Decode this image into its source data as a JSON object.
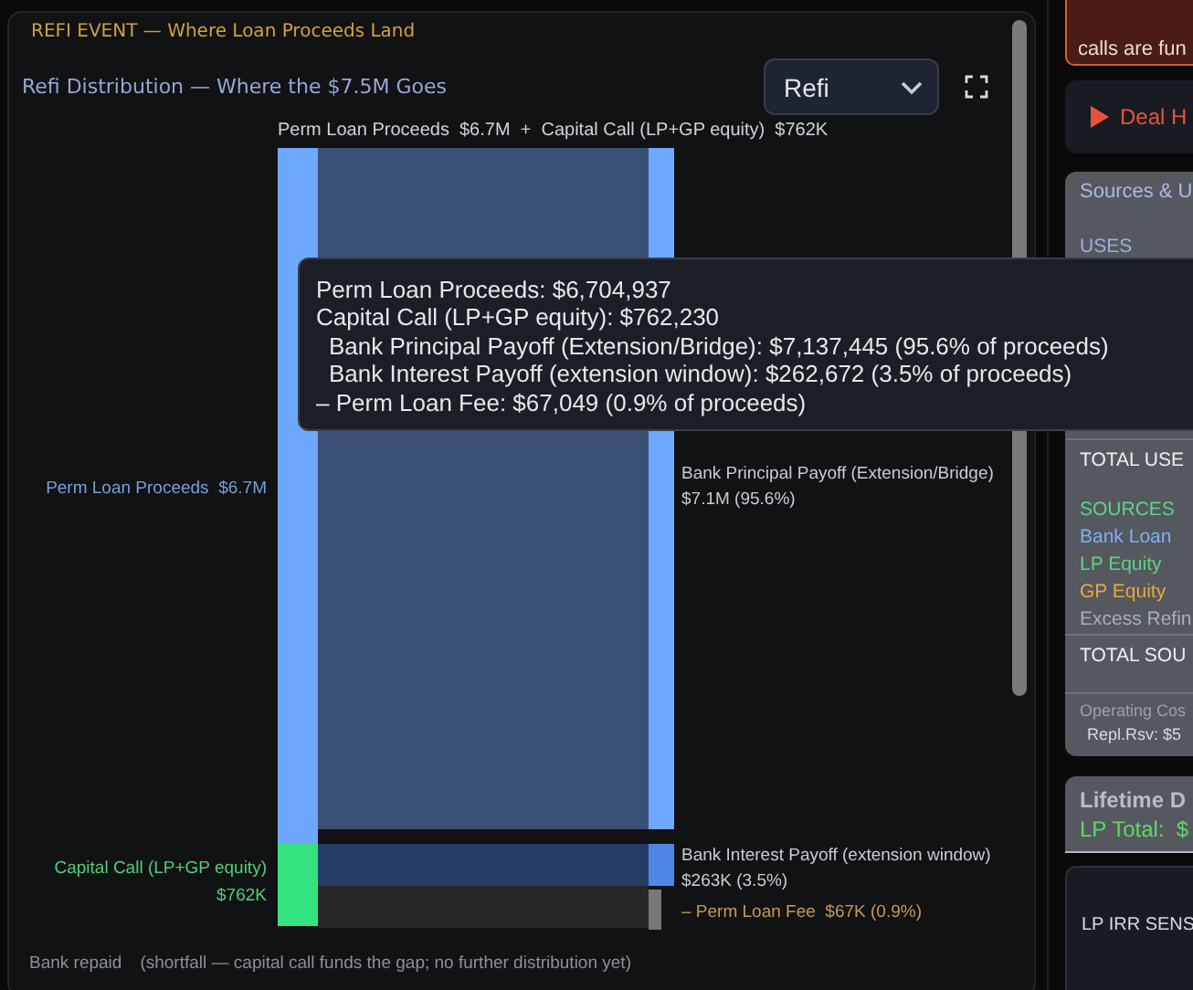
{
  "panel": {
    "caption": "REFI EVENT — Where Loan Proceeds Land",
    "title": "Refi Distribution — Where the $7.5M Goes",
    "view_select": {
      "value": "Refi"
    },
    "flow": {
      "header": "Perm Loan Proceeds  $6.7M  +  Capital Call (LP+GP equity)  $762K",
      "sources": [
        {
          "lines": [
            "Perm Loan Proceeds  $6.7M"
          ],
          "color": "#6ea8fe"
        },
        {
          "lines": [
            "Capital Call (LP+GP equity)",
            "$762K"
          ],
          "color": "#34e37f"
        }
      ],
      "uses": [
        {
          "lines": [
            "Bank Principal Payoff (Extension/Bridge)",
            "$7.1M (95.6%)"
          ],
          "color": "#6ea8fe"
        },
        {
          "lines": [
            "Bank Interest Payoff (extension window)",
            "$263K (3.5%)"
          ],
          "color": "#4f85e6"
        },
        {
          "lines": [
            "– Perm Loan Fee  $67K (0.9%)"
          ],
          "color": "#777777"
        }
      ]
    },
    "footer": {
      "status": "Bank repaid",
      "note": "(shortfall — capital call funds the gap; no further distribution yet)"
    },
    "tooltip": {
      "lines": [
        {
          "text": "Perm Loan Proceeds: $6,704,937",
          "indent": false
        },
        {
          "text": "Capital Call (LP+GP equity): $762,230",
          "indent": false
        },
        {
          "text": "Bank Principal Payoff (Extension/Bridge): $7,137,445 (95.6% of proceeds)",
          "indent": true
        },
        {
          "text": "Bank Interest Payoff (extension window): $262,672 (3.5% of proceeds)",
          "indent": true
        },
        {
          "text": "– Perm Loan Fee: $67,049 (0.9% of proceeds)",
          "indent": false
        }
      ]
    }
  },
  "sidebar": {
    "alert": {
      "text": "calls are fun"
    },
    "deal_button": {
      "label": "Deal H"
    },
    "sources_uses": {
      "title": "Sources & U",
      "uses": {
        "heading": "USES",
        "total": "TOTAL USE"
      },
      "sources": {
        "heading": "SOURCES",
        "items": [
          {
            "text": "Bank Loan",
            "color": "#7fb0f0"
          },
          {
            "text": "LP Equity",
            "color": "#5fd28a"
          },
          {
            "text": "GP Equity",
            "color": "#e8a840"
          },
          {
            "text": "Excess Refin",
            "color": "#a9adb4"
          }
        ],
        "total": "TOTAL SOU"
      },
      "footnotes": [
        "Operating Cos",
        "Repl.Rsv:  $5"
      ]
    },
    "lifetime": {
      "title": "Lifetime D",
      "lp_total": "LP Total:  $"
    },
    "irr": {
      "title": "LP IRR SENS"
    }
  }
}
